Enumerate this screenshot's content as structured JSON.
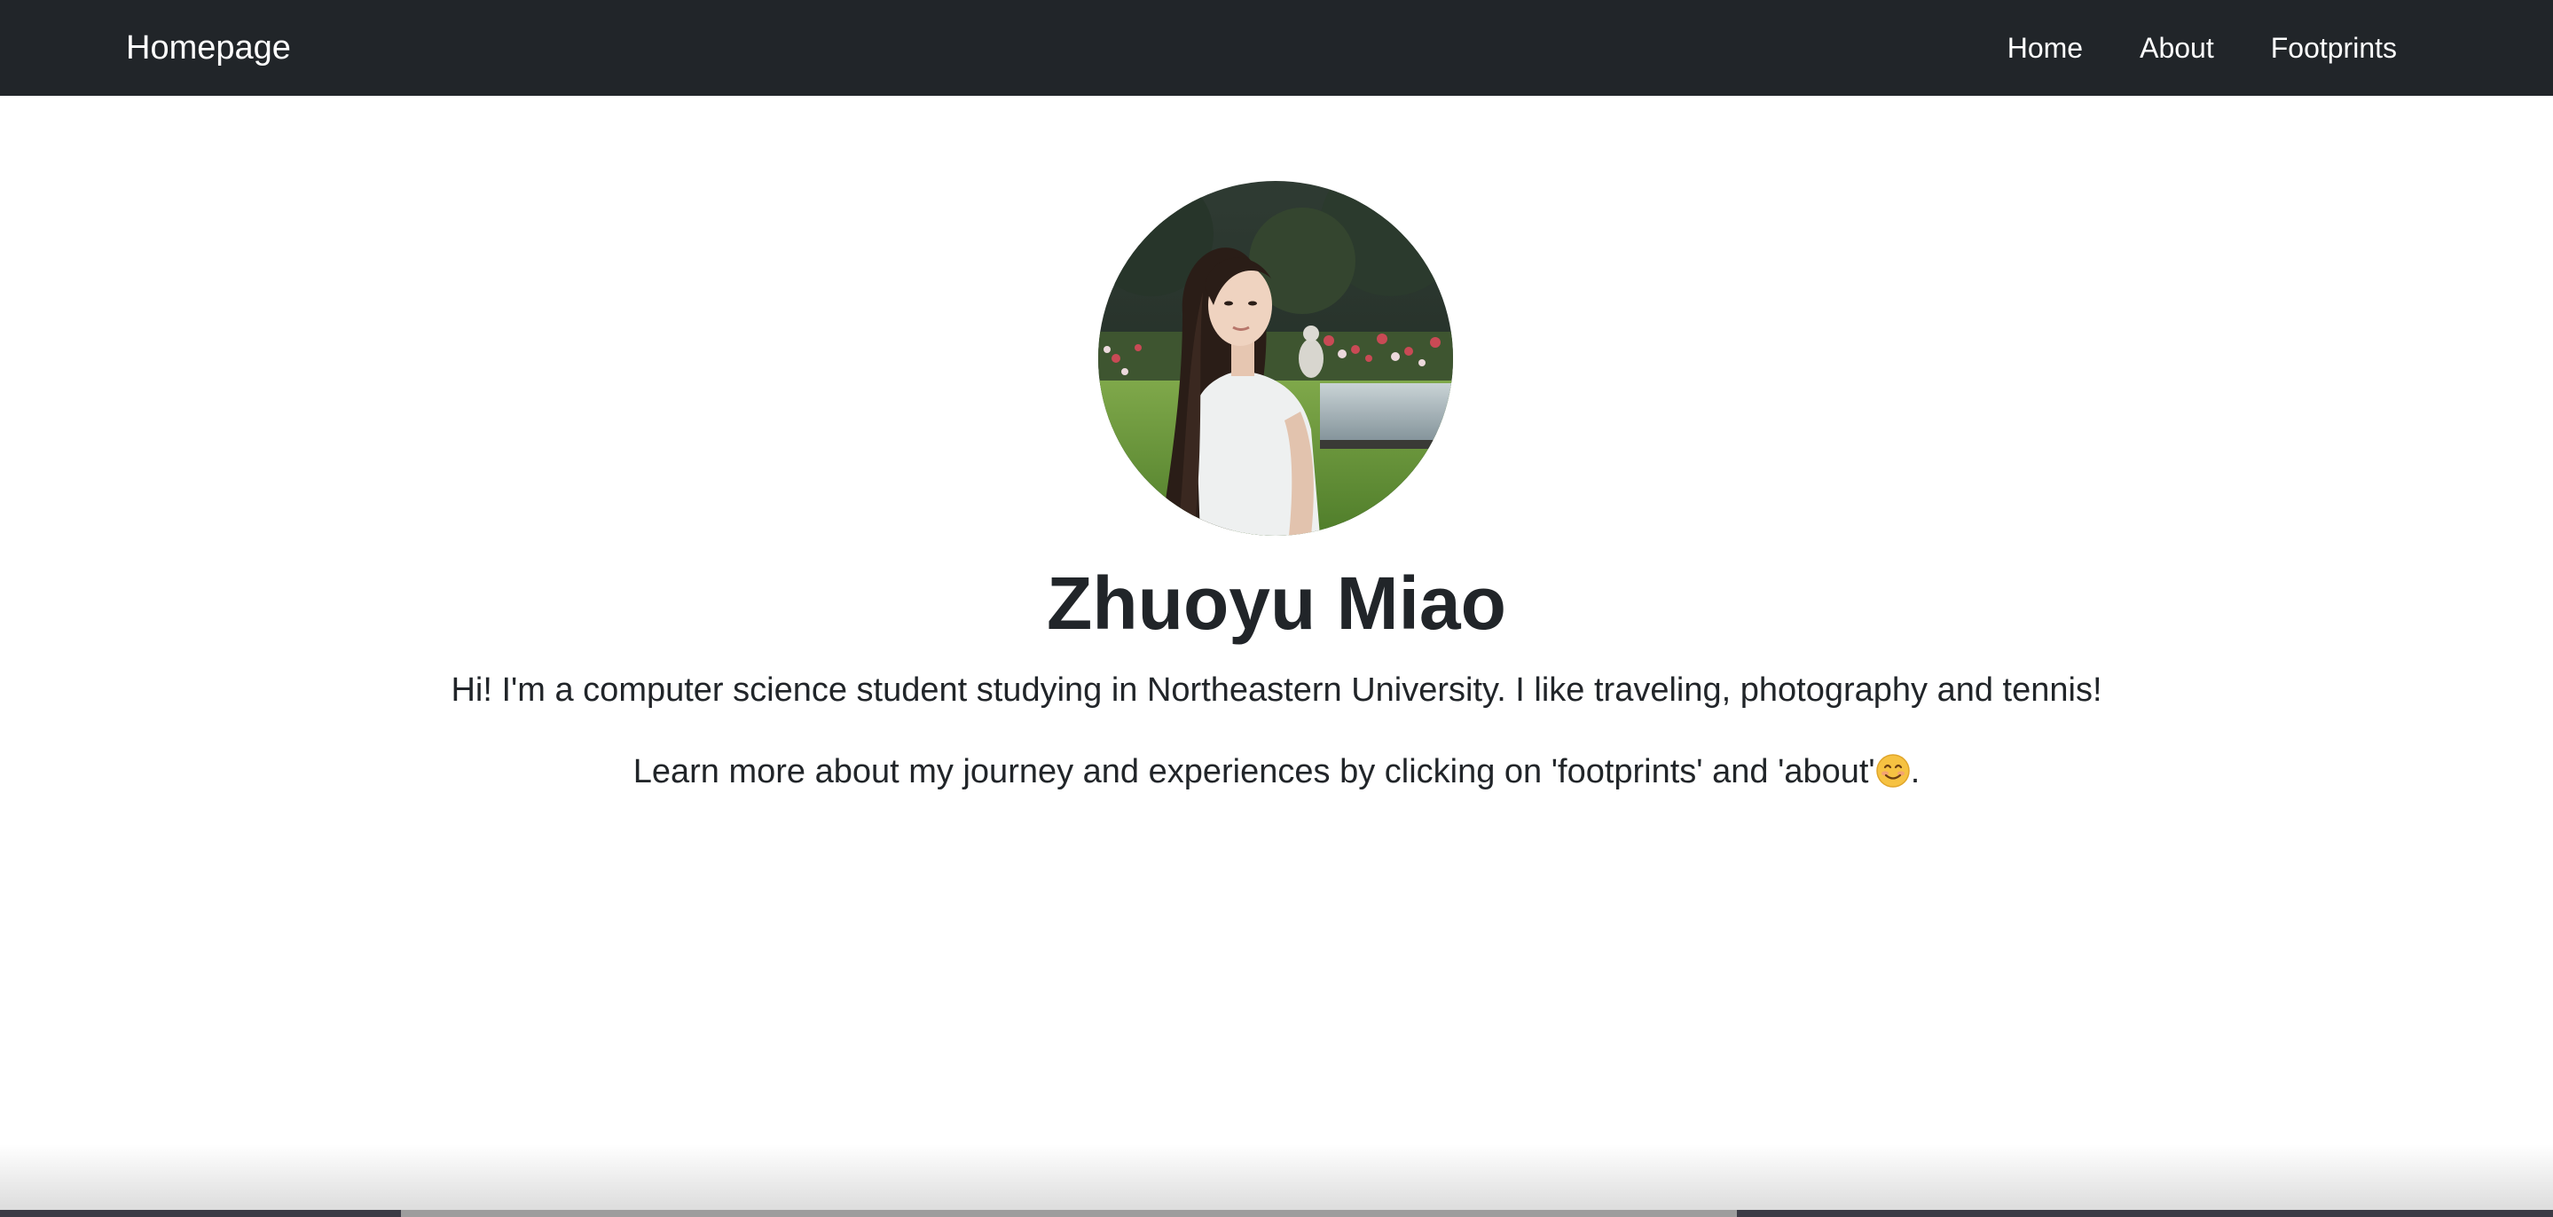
{
  "navbar": {
    "brand": "Homepage",
    "links": [
      {
        "label": "Home"
      },
      {
        "label": "About"
      },
      {
        "label": "Footprints"
      }
    ]
  },
  "profile": {
    "avatar_icon": "profile-photo",
    "name": "Zhuoyu Miao",
    "bio_line_1": "Hi! I'm a computer science student studying in Northeastern University. I like traveling, photography and tennis!",
    "bio_line_2_text": "Learn more about my journey and experiences by clicking on 'footprints' and 'about'",
    "bio_line_2_emoji": "smiling-face-icon",
    "bio_line_2_end": "."
  },
  "colors": {
    "navbar_bg": "#212529",
    "nav_text": "#ffffff",
    "body_text": "#212529",
    "page_bg": "#ffffff"
  }
}
